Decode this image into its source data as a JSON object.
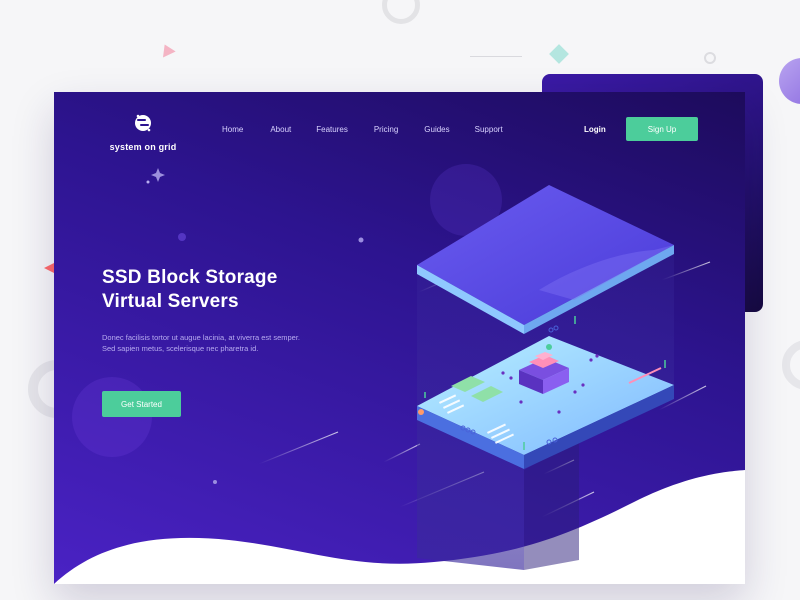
{
  "brand": {
    "name": "system on grid"
  },
  "nav": {
    "items": [
      "Home",
      "About",
      "Features",
      "Pricing",
      "Guides",
      "Support"
    ],
    "login_label": "Login",
    "signup_label": "Sign Up"
  },
  "hero": {
    "headline_line1": "SSD Block Storage",
    "headline_line2": "Virtual Servers",
    "body_line1": "Donec facilisis tortor ut augue lacinia, at viverra est semper.",
    "body_line2": "Sed sapien metus, scelerisque nec pharetra id.",
    "cta_label": "Get Started"
  },
  "colors": {
    "accent_green": "#4ccd9b",
    "hero_dark": "#1d0b5c",
    "hero_purple": "#4a22c4",
    "page_bg": "#f6f6f8"
  },
  "icons": {
    "logo": "grid-globe-icon",
    "illustration": "isometric-server-board"
  }
}
